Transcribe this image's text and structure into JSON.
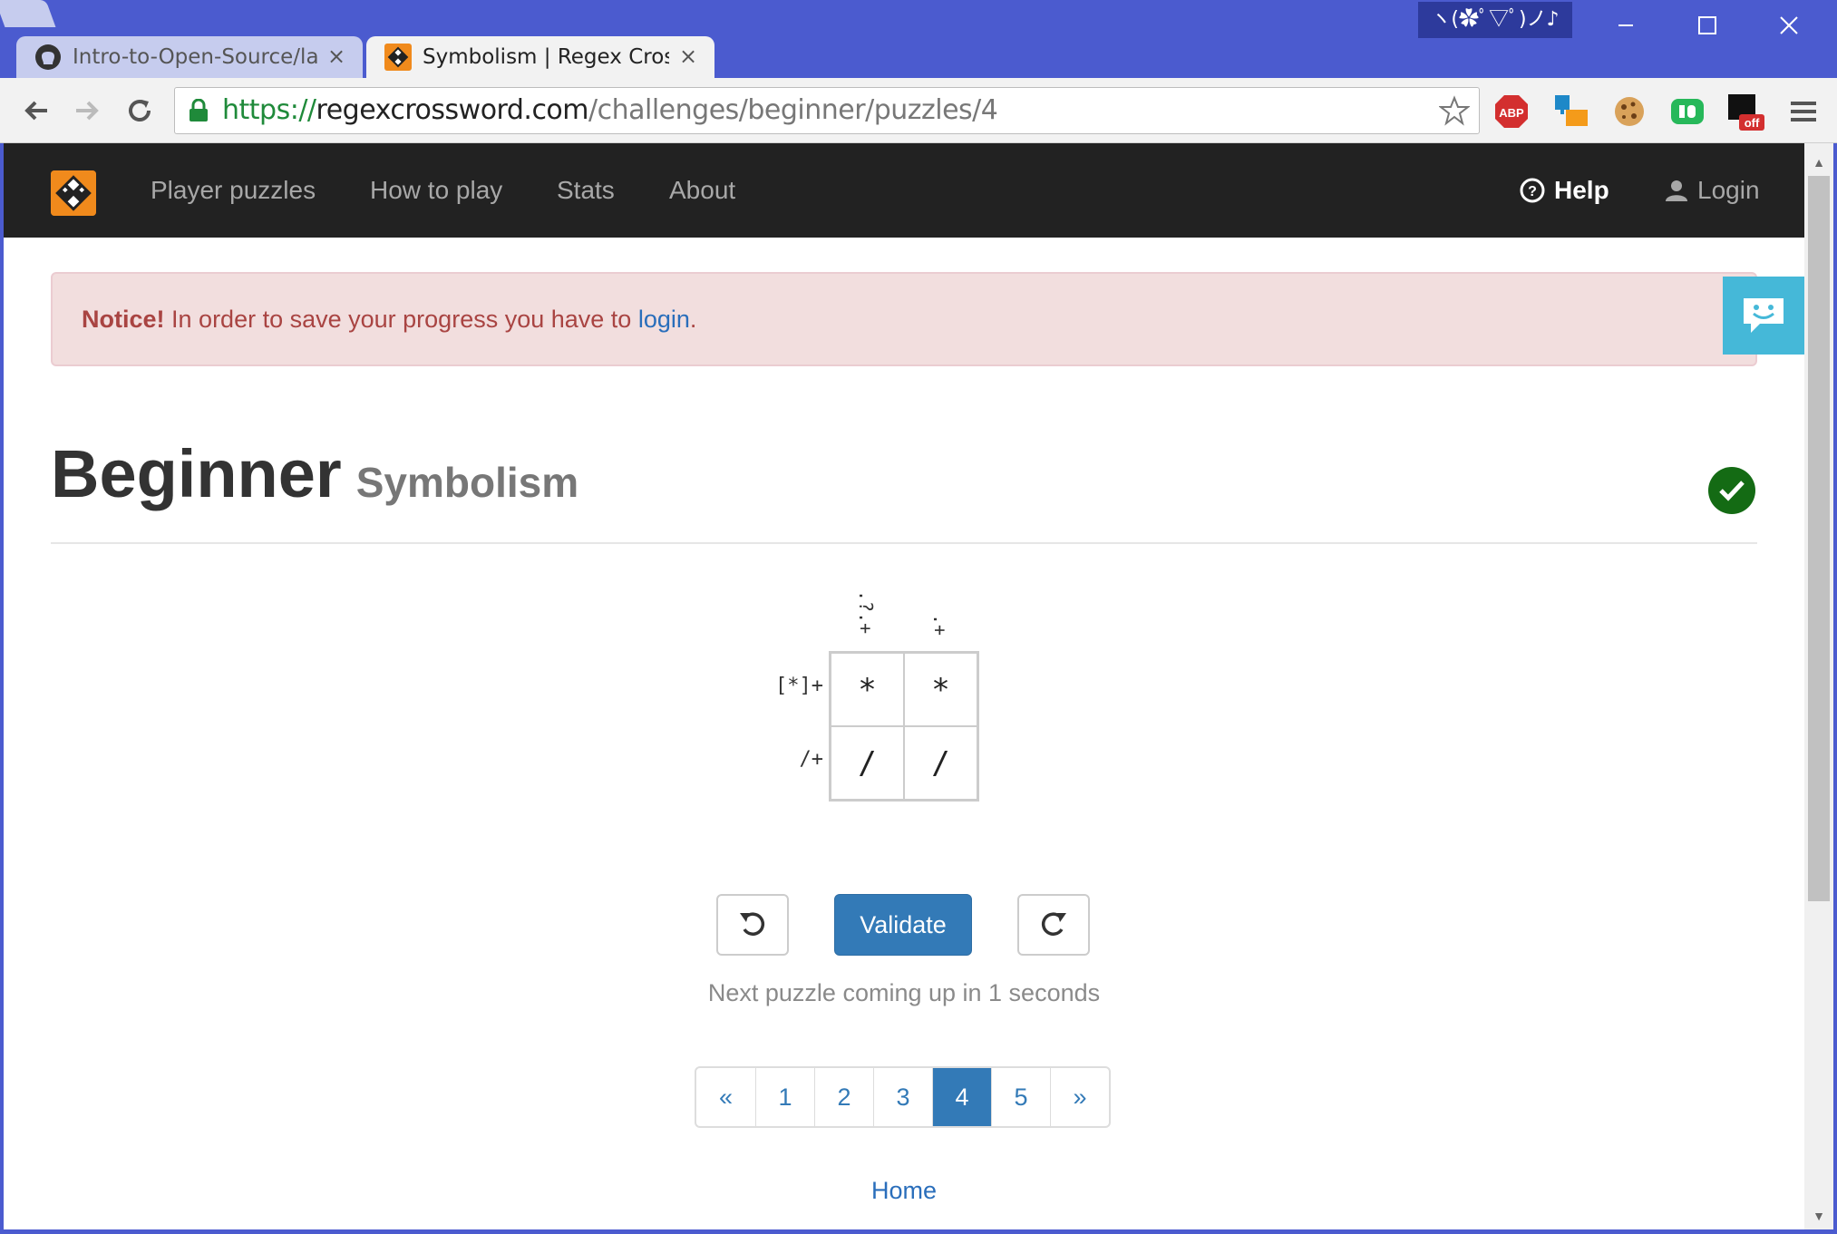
{
  "window": {
    "kaomoji": "ヽ(✿ﾟ▽ﾟ)ノ♪"
  },
  "tabs": [
    {
      "title": "Intro-to-Open-Source/lab",
      "favicon": "github-icon",
      "active": false
    },
    {
      "title": "Symbolism | Regex Crossw",
      "favicon": "regexcrossword-icon",
      "active": true
    }
  ],
  "address_bar": {
    "scheme": "https://",
    "host": "regexcrossword.com",
    "path": "/challenges/beginner/puzzles/4"
  },
  "extensions": [
    "adblock-plus-icon",
    "extension-icon",
    "cookie-icon",
    "pushbullet-icon",
    "extension-off-icon",
    "chrome-menu-icon"
  ],
  "navbar": {
    "links": [
      "Player puzzles",
      "How to play",
      "Stats",
      "About"
    ],
    "help": "Help",
    "login": "Login"
  },
  "alert": {
    "strong": "Notice!",
    "text": "In order to save your progress you have to",
    "link": "login",
    "end": "."
  },
  "page": {
    "title": "Beginner",
    "subtitle": "Symbolism"
  },
  "puzzle": {
    "column_clues": [
      ".?.+",
      ".+"
    ],
    "row_clues": [
      "[*]+",
      "/+"
    ],
    "cells": [
      [
        "*",
        "*"
      ],
      [
        "/",
        "/"
      ]
    ]
  },
  "controls": {
    "validate": "Validate",
    "next_message": "Next puzzle coming up in 1 seconds"
  },
  "pagination": {
    "items": [
      "«",
      "1",
      "2",
      "3",
      "4",
      "5",
      "»"
    ],
    "active": "4"
  },
  "footer": {
    "home": "Home"
  },
  "colors": {
    "chrome": "#4b5bcf",
    "navbar": "#222222",
    "brand": "#f08a1c",
    "primary": "#337ab7",
    "alert_bg": "#f2dede",
    "alert_text": "#a94442",
    "solved": "#146b14",
    "chat": "#45b8d8"
  }
}
